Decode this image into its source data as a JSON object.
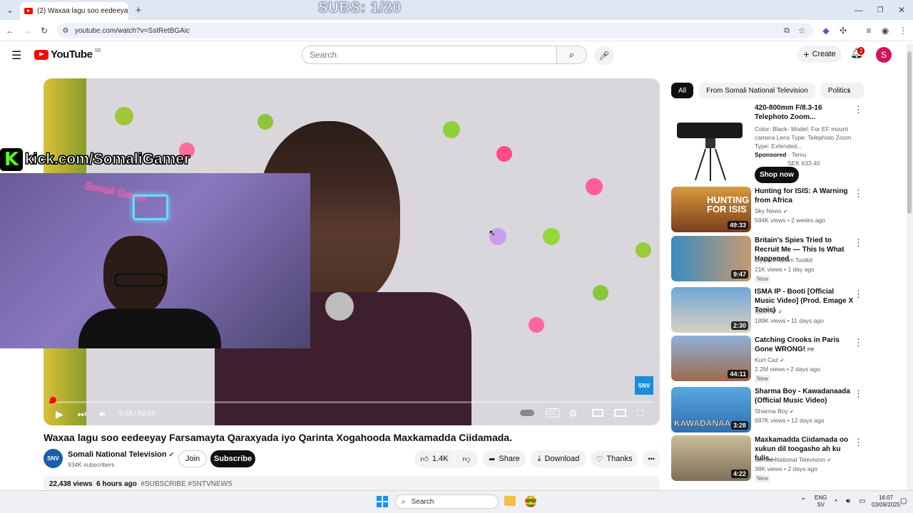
{
  "browser": {
    "tab_title": "(2) Waxaa lagu soo eedeeyay",
    "new_tab": "+",
    "url": "youtube.com/watch?v=SstRetBGAic",
    "window_controls": [
      "—",
      "❐",
      "✕"
    ]
  },
  "overlay": {
    "subs_counter": "SUBS: 1/20",
    "kick_url": "kick.com/SomaliGamer",
    "kick_letter": "K",
    "webcam_neon_text": "Somali Gamer"
  },
  "youtube": {
    "logo_text": "YouTube",
    "country_code": "SE",
    "search_placeholder": "Search",
    "create_label": "Create",
    "notification_count": "2",
    "avatar_letter": "S"
  },
  "player": {
    "time": "0:18 / 52:59",
    "progress": 0.0057,
    "watermark": "SNV",
    "autoplay": "on"
  },
  "video": {
    "title": "Waxaa lagu soo eedeeyay Farsamayta Qaraxyada iyo Qarinta Xogahooda Maxkamadda Ciidamada.",
    "channel_name": "Somali National Television",
    "channel_avatar_text": "SNV",
    "subscribers": "934K subscribers",
    "join_label": "Join",
    "subscribe_label": "Subscribe",
    "likes": "1.4K",
    "share_label": "Share",
    "download_label": "Download",
    "thanks_label": "Thanks",
    "more_label": "•••",
    "views": "22,438 views",
    "age": "6 hours ago",
    "hashtags": "#SUBSCRIBE #SNTVNEWS"
  },
  "chips": [
    "All",
    "From Somali National Television",
    "Politics"
  ],
  "recommendations": [
    {
      "title": "420-800mm F/8.3-16 Telephoto Zoom...",
      "desc": "Color: Black- Model: For EF mount camera Lens Type: Telephoto Zoom Type: Extended...",
      "sponsored": "Sponsored",
      "advertiser": "Temu",
      "price": "SEK 633.40",
      "cta": "Shop now"
    },
    {
      "title": "Hunting for ISIS: A Warning from Africa",
      "channel": "Sky News",
      "meta": "594K views • 2 weeks ago",
      "duration": "49:33",
      "thumb_text": "HUNTING FOR ISIS",
      "color": "#c0752a"
    },
    {
      "title": "Britain's Spies Tried to Recruit Me — This Is What Happened",
      "channel": "My Journalism Toolkit",
      "meta": "21K views • 1 day ago",
      "duration": "9:47",
      "badge": "New",
      "color": "#2d7fb0"
    },
    {
      "title": "ISMA IP - Booti [Official Music Video] (Prod. Emage X Tonic)",
      "channel": "ISMA IP",
      "meta": "189K views • 11 days ago",
      "duration": "2:30",
      "color": "#6a9cc4"
    },
    {
      "title": "Catching Crooks in Paris Gone WRONG!",
      "title_suffix": "FR",
      "channel": "Kurt Caz",
      "meta": "2.2M views • 2 days ago",
      "duration": "44:11",
      "badge": "New",
      "color": "#8aa3c8"
    },
    {
      "title": "Sharma Boy - Kawadanaada (Official Music Video)",
      "channel": "Sharma Boy",
      "meta": "687K views • 12 days ago",
      "duration": "3:28",
      "thumb_text": "KAWADANAA",
      "color": "#3a8fc8"
    },
    {
      "title": "Maxkamadda Ciidamada oo xukun dil toogasho ah ku fulis...",
      "channel": "Somali National Television",
      "meta": "38K views • 2 days ago",
      "duration": "4:22",
      "badge": "New",
      "color": "#a89a78"
    }
  ],
  "taskbar": {
    "search_placeholder": "Search",
    "lang_top": "ENG",
    "lang_bottom": "SV",
    "time": "16:07",
    "date": "03/09/2025"
  }
}
